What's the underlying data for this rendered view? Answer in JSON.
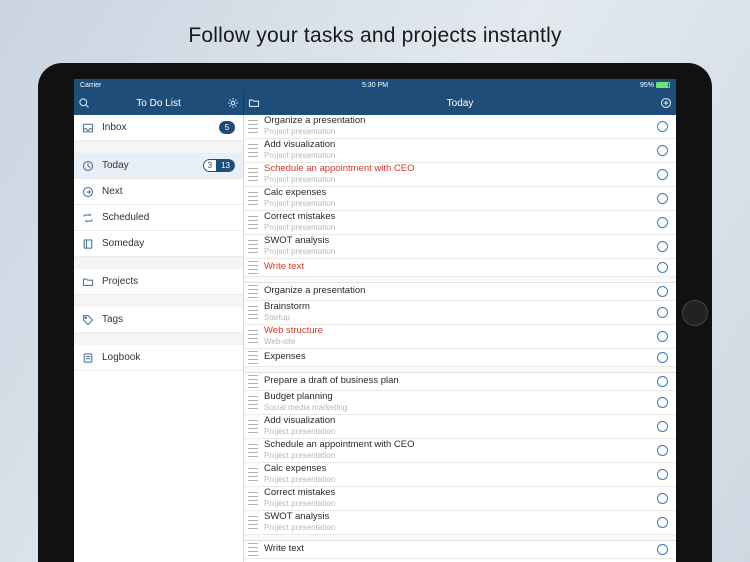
{
  "promo": {
    "title": "Follow your tasks and projects instantly"
  },
  "status": {
    "carrier": "Carrier",
    "time": "5:30 PM",
    "battery": "95%"
  },
  "nav": {
    "left_title": "To Do List",
    "right_title": "Today"
  },
  "sidebar": {
    "groups": [
      [
        {
          "icon": "inbox",
          "label": "Inbox",
          "badge": "5"
        }
      ],
      [
        {
          "icon": "clock",
          "label": "Today",
          "active": true,
          "badge_pair": [
            "3",
            "13"
          ]
        },
        {
          "icon": "arrow",
          "label": "Next"
        },
        {
          "icon": "repeat",
          "label": "Scheduled"
        },
        {
          "icon": "book",
          "label": "Someday"
        }
      ],
      [
        {
          "icon": "folder",
          "label": "Projects"
        }
      ],
      [
        {
          "icon": "tag",
          "label": "Tags"
        }
      ],
      [
        {
          "icon": "log",
          "label": "Logbook"
        }
      ]
    ]
  },
  "tasks": [
    [
      {
        "title": "Organize a presentation",
        "sub": "Project presentation"
      },
      {
        "title": "Add visualization",
        "sub": "Project presentation"
      },
      {
        "title": "Schedule an appointment with CEO",
        "sub": "Project presentation",
        "red": true
      },
      {
        "title": "Calc expenses",
        "sub": "Project presentation"
      },
      {
        "title": "Correct mistakes",
        "sub": "Project presentation"
      },
      {
        "title": "SWOT analysis",
        "sub": "Project presentation"
      },
      {
        "title": "Write text",
        "red": true
      }
    ],
    [
      {
        "title": "Organize a presentation"
      },
      {
        "title": "Brainstorm",
        "sub": "Startup"
      },
      {
        "title": "Web structure",
        "sub": "Web-site",
        "red": true
      },
      {
        "title": "Expenses"
      }
    ],
    [
      {
        "title": "Prepare a draft of business plan"
      },
      {
        "title": "Budget planning",
        "sub": "Social media marketing"
      },
      {
        "title": "Add visualization",
        "sub": "Project presentation"
      },
      {
        "title": "Schedule an appointment with CEO",
        "sub": "Project presentation"
      },
      {
        "title": "Calc expenses",
        "sub": "Project presentation"
      },
      {
        "title": "Correct mistakes",
        "sub": "Project presentation"
      },
      {
        "title": "SWOT analysis",
        "sub": "Project presentation"
      }
    ],
    [
      {
        "title": "Write text"
      }
    ]
  ]
}
